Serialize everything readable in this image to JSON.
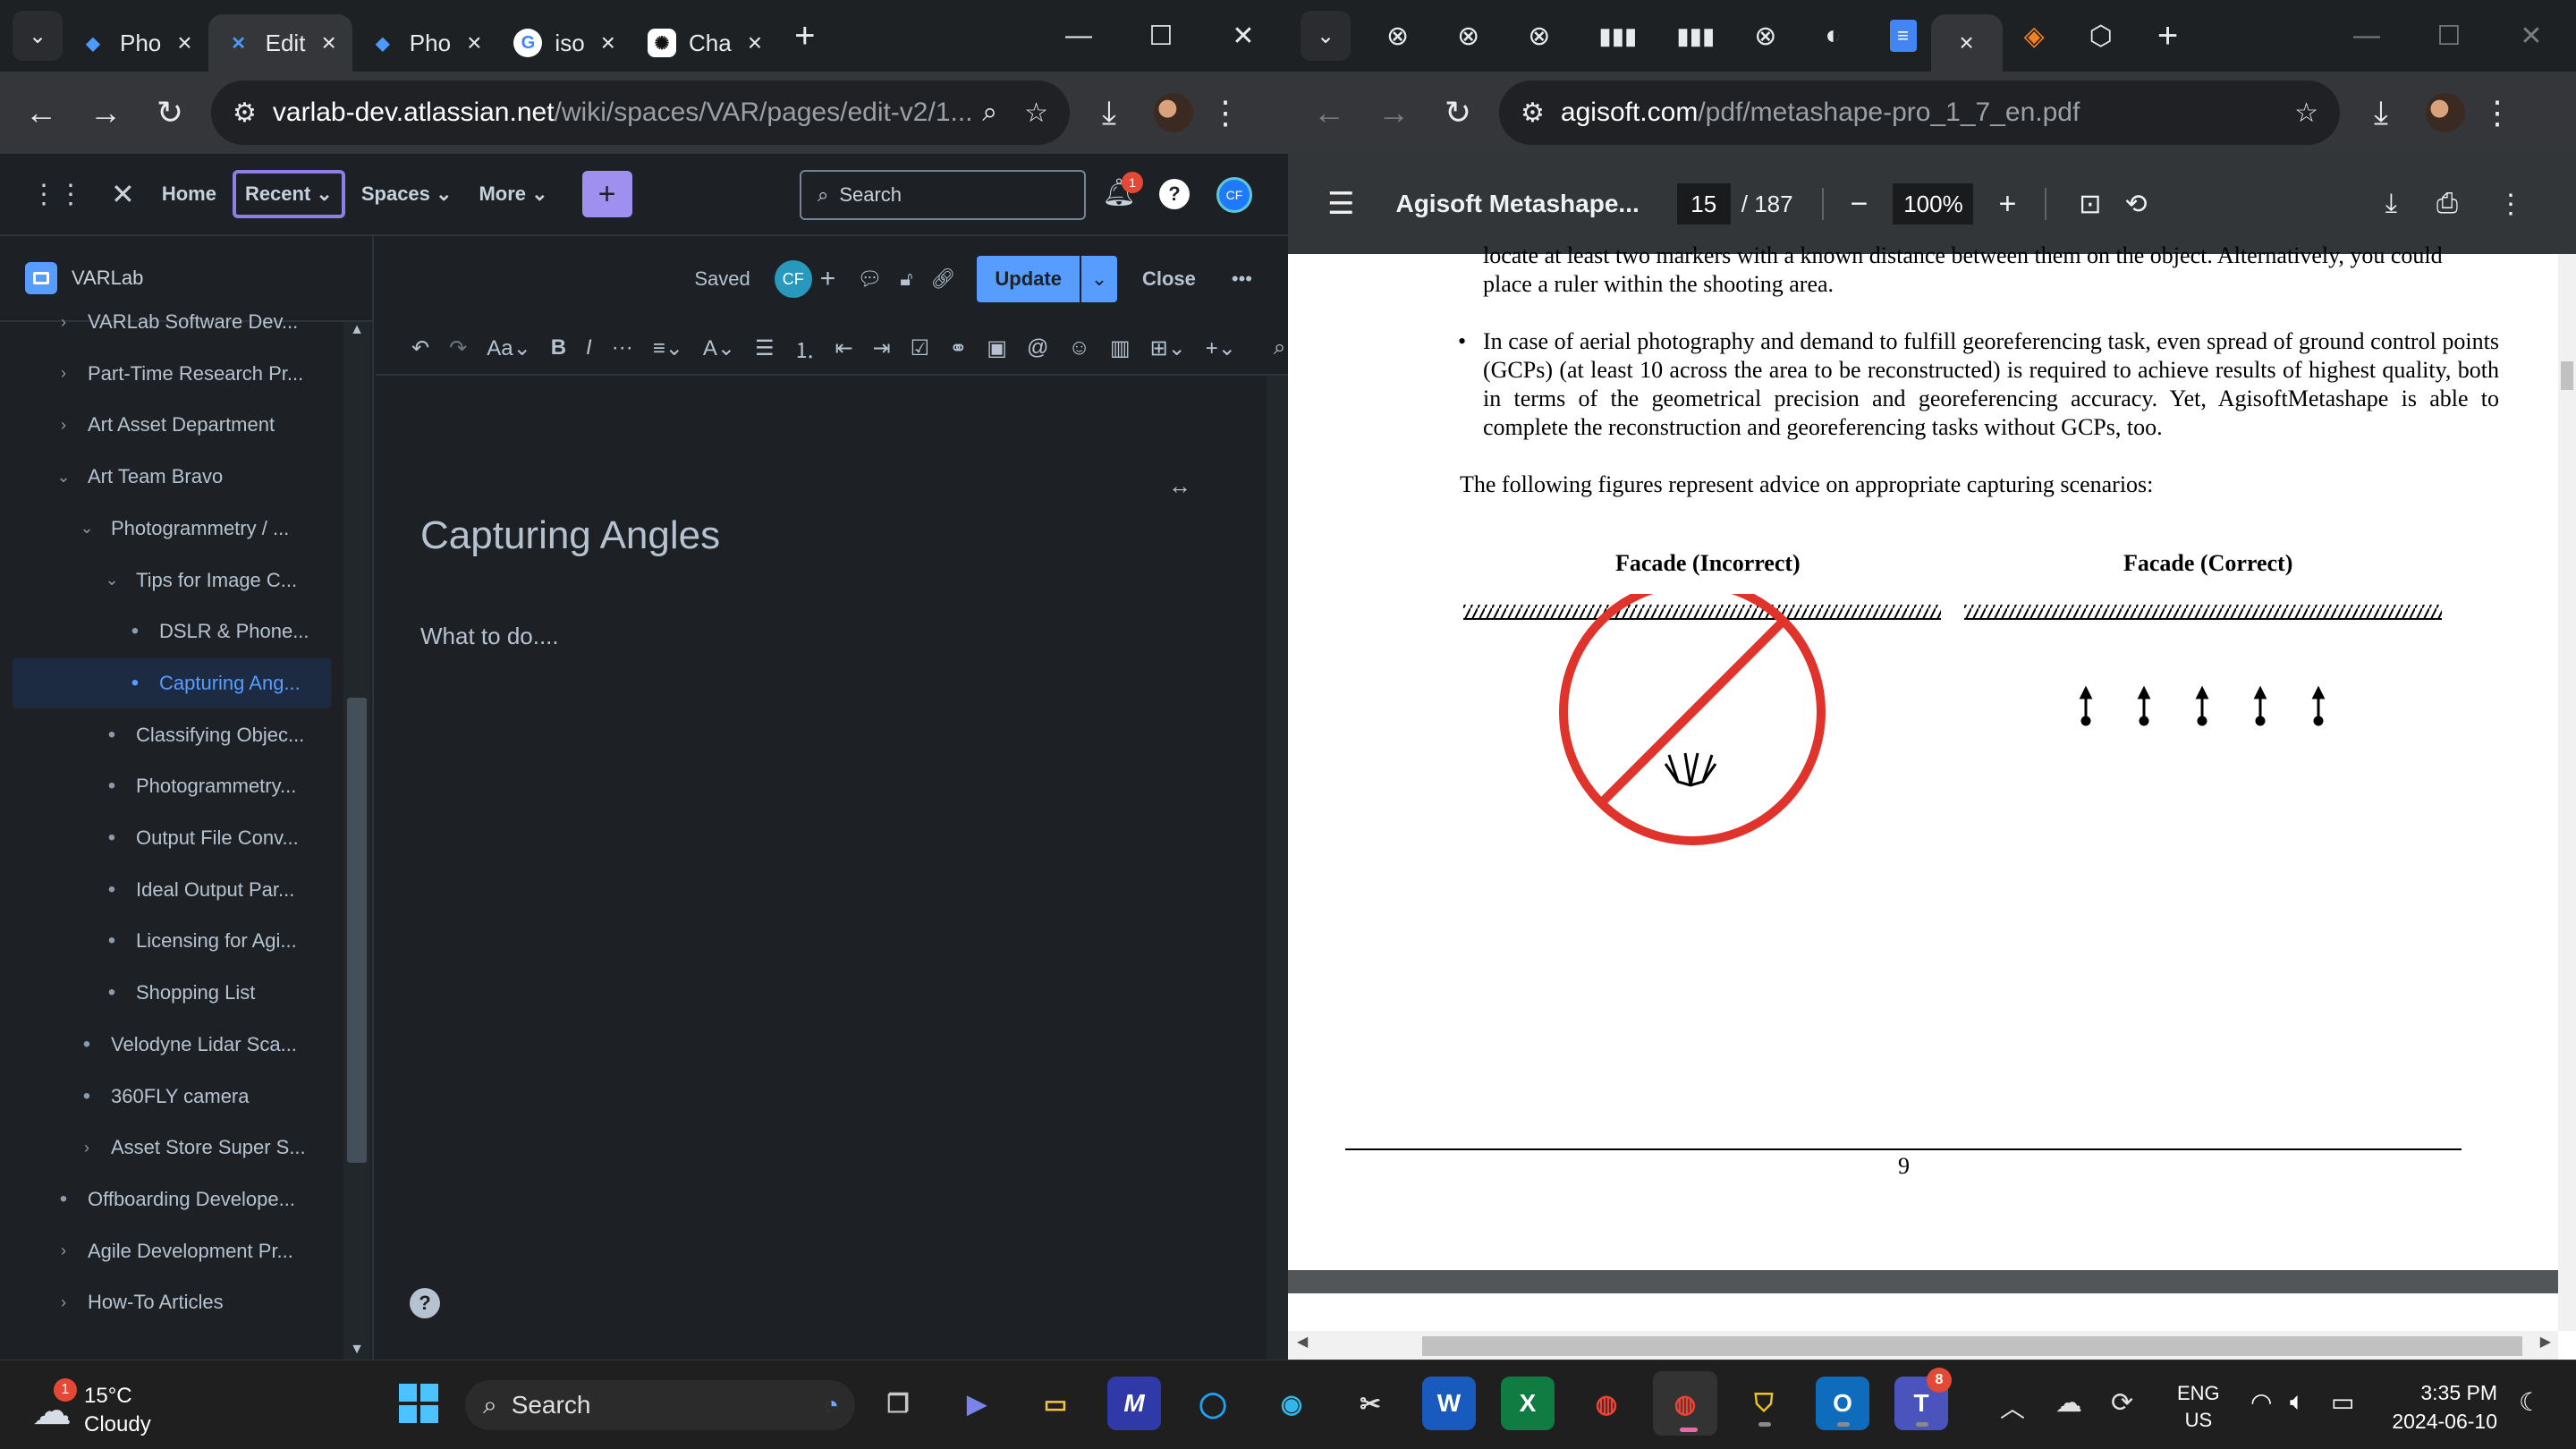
{
  "left_window": {
    "tabs": [
      {
        "label": "Pho",
        "active": false
      },
      {
        "label": "Edit",
        "active": true
      },
      {
        "label": "Pho",
        "active": false
      },
      {
        "label": "iso",
        "active": false
      },
      {
        "label": "Cha",
        "active": false
      }
    ],
    "url_host": "varlab-dev.atlassian.net",
    "url_path": "/wiki/spaces/VAR/pages/edit-v2/1..."
  },
  "right_window": {
    "url_host": "agisoft.com",
    "url_path": "/pdf/metashape-pro_1_7_en.pdf"
  },
  "confluence": {
    "nav": {
      "home": "Home",
      "recent": "Recent",
      "spaces": "Spaces",
      "more": "More",
      "search_label": "Search",
      "notification_count": "1",
      "avatar_initials": "CF"
    },
    "space_name": "VARLab",
    "tree": [
      {
        "label": "VARLab Software Dev...",
        "marker": "›",
        "indent": 0
      },
      {
        "label": "Part-Time Research Pr...",
        "marker": "›",
        "indent": 0
      },
      {
        "label": "Art Asset Department",
        "marker": "›",
        "indent": 0
      },
      {
        "label": "Art Team Bravo",
        "marker": "⌄",
        "indent": 0
      },
      {
        "label": "Photogrammetry / ...",
        "marker": "⌄",
        "indent": 1
      },
      {
        "label": "Tips for Image C...",
        "marker": "⌄",
        "indent": 2
      },
      {
        "label": "DSLR & Phone...",
        "marker": "•",
        "indent": 3
      },
      {
        "label": "Capturing Ang...",
        "marker": "•",
        "indent": 3,
        "selected": true
      },
      {
        "label": "Classifying Objec...",
        "marker": "•",
        "indent": 2
      },
      {
        "label": "Photogrammetry...",
        "marker": "•",
        "indent": 2
      },
      {
        "label": "Output File Conv...",
        "marker": "•",
        "indent": 2
      },
      {
        "label": "Ideal Output Par...",
        "marker": "•",
        "indent": 2
      },
      {
        "label": "Licensing for Agi...",
        "marker": "•",
        "indent": 2
      },
      {
        "label": "Shopping List",
        "marker": "•",
        "indent": 2
      },
      {
        "label": "Velodyne Lidar Sca...",
        "marker": "•",
        "indent": 1
      },
      {
        "label": "360FLY camera",
        "marker": "•",
        "indent": 1
      },
      {
        "label": "Asset Store Super S...",
        "marker": "›",
        "indent": 1
      },
      {
        "label": "Offboarding Develope...",
        "marker": "•",
        "indent": 0
      },
      {
        "label": "Agile Development Pr...",
        "marker": "›",
        "indent": 0
      },
      {
        "label": "How-To Articles",
        "marker": "›",
        "indent": 0
      }
    ],
    "editor": {
      "saved_label": "Saved",
      "update_label": "Update",
      "close_label": "Close",
      "title": "Capturing Angles",
      "body": "What to do...."
    }
  },
  "pdf": {
    "doc_title": "Agisoft Metashape...",
    "page_current": "15",
    "page_total": "/ 187",
    "zoom": "100%",
    "cut_line": "locate at least two markers with a known distance between them on the object. Alternatively, you could",
    "line_ruler": "place a ruler within the shooting area.",
    "bullet_text": "In case of aerial photography and demand to fulfill georeferencing task, even spread of ground control points (GCPs) (at least 10 across the area to be reconstructed) is required to achieve results of highest quality, both in terms of the geometrical precision and georeferencing accuracy. Yet, AgisoftMetashape is able to complete the reconstruction and georeferencing tasks without GCPs, too.",
    "intro_line": "The following figures represent advice on appropriate capturing scenarios:",
    "fig_left_title": "Facade (Incorrect)",
    "fig_right_title": "Facade (Correct)",
    "page_number": "9"
  },
  "taskbar": {
    "weather_temp": "15°C",
    "weather_desc": "Cloudy",
    "weather_badge": "1",
    "search_label": "Search",
    "lang_top": "ENG",
    "lang_bottom": "US",
    "time": "3:35 PM",
    "date": "2024-06-10",
    "teams_badge": "8"
  }
}
